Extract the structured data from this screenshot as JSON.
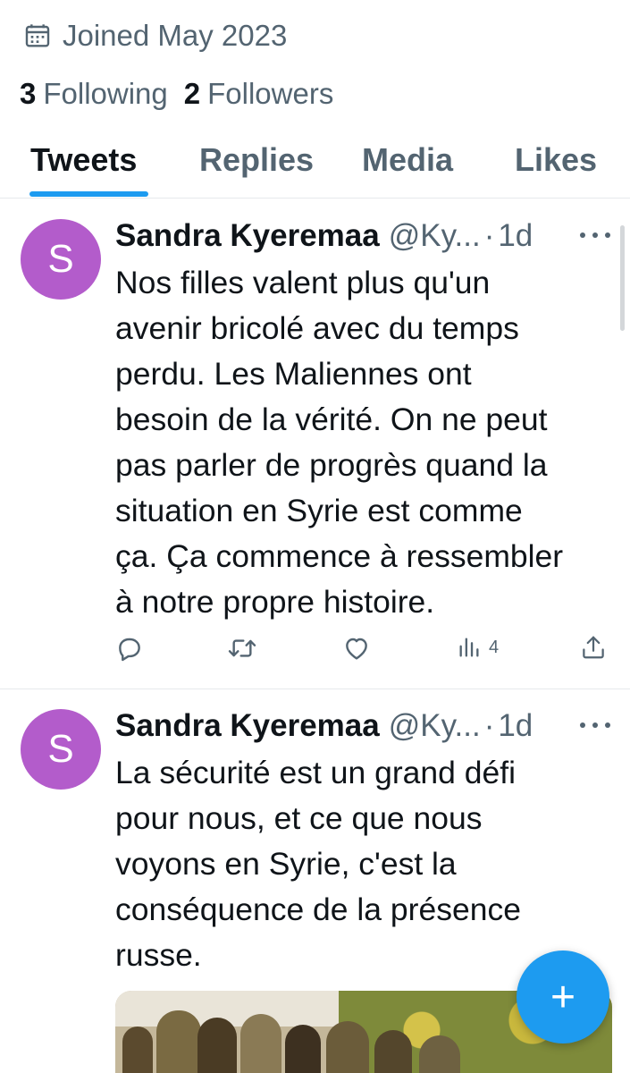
{
  "profile": {
    "joined": "Joined May 2023",
    "following_count": "3",
    "following_label": "Following",
    "followers_count": "2",
    "followers_label": "Followers"
  },
  "tabs": [
    {
      "label": "Tweets",
      "active": true
    },
    {
      "label": "Replies",
      "active": false
    },
    {
      "label": "Media",
      "active": false
    },
    {
      "label": "Likes",
      "active": false
    }
  ],
  "tweets": [
    {
      "avatar_letter": "S",
      "name": "Sandra Kyeremaa",
      "handle": "@Ky...",
      "separator": "·",
      "time": "1d",
      "text": "Nos filles valent plus qu'un\navenir bricolé avec du temps\nperdu. Les Maliennes ont\nbesoin de la vérité. On ne peut\npas parler de progrès quand la\nsituation en Syrie est comme\nça. Ça commence à ressembler\nà notre propre histoire.",
      "views": "4"
    },
    {
      "avatar_letter": "S",
      "name": "Sandra Kyeremaa",
      "handle": "@Ky...",
      "separator": "·",
      "time": "1d",
      "text": "La sécurité est un grand défi\npour nous, et ce que nous\nvoyons en Syrie, c'est la\nconséquence de la présence\nrusse."
    }
  ],
  "compose": {
    "icon": "plus-icon",
    "glyph": "+"
  },
  "colors": {
    "accent": "#1d9bf0",
    "avatar": "#b35ccb",
    "muted": "#536471",
    "text": "#0f1419"
  }
}
